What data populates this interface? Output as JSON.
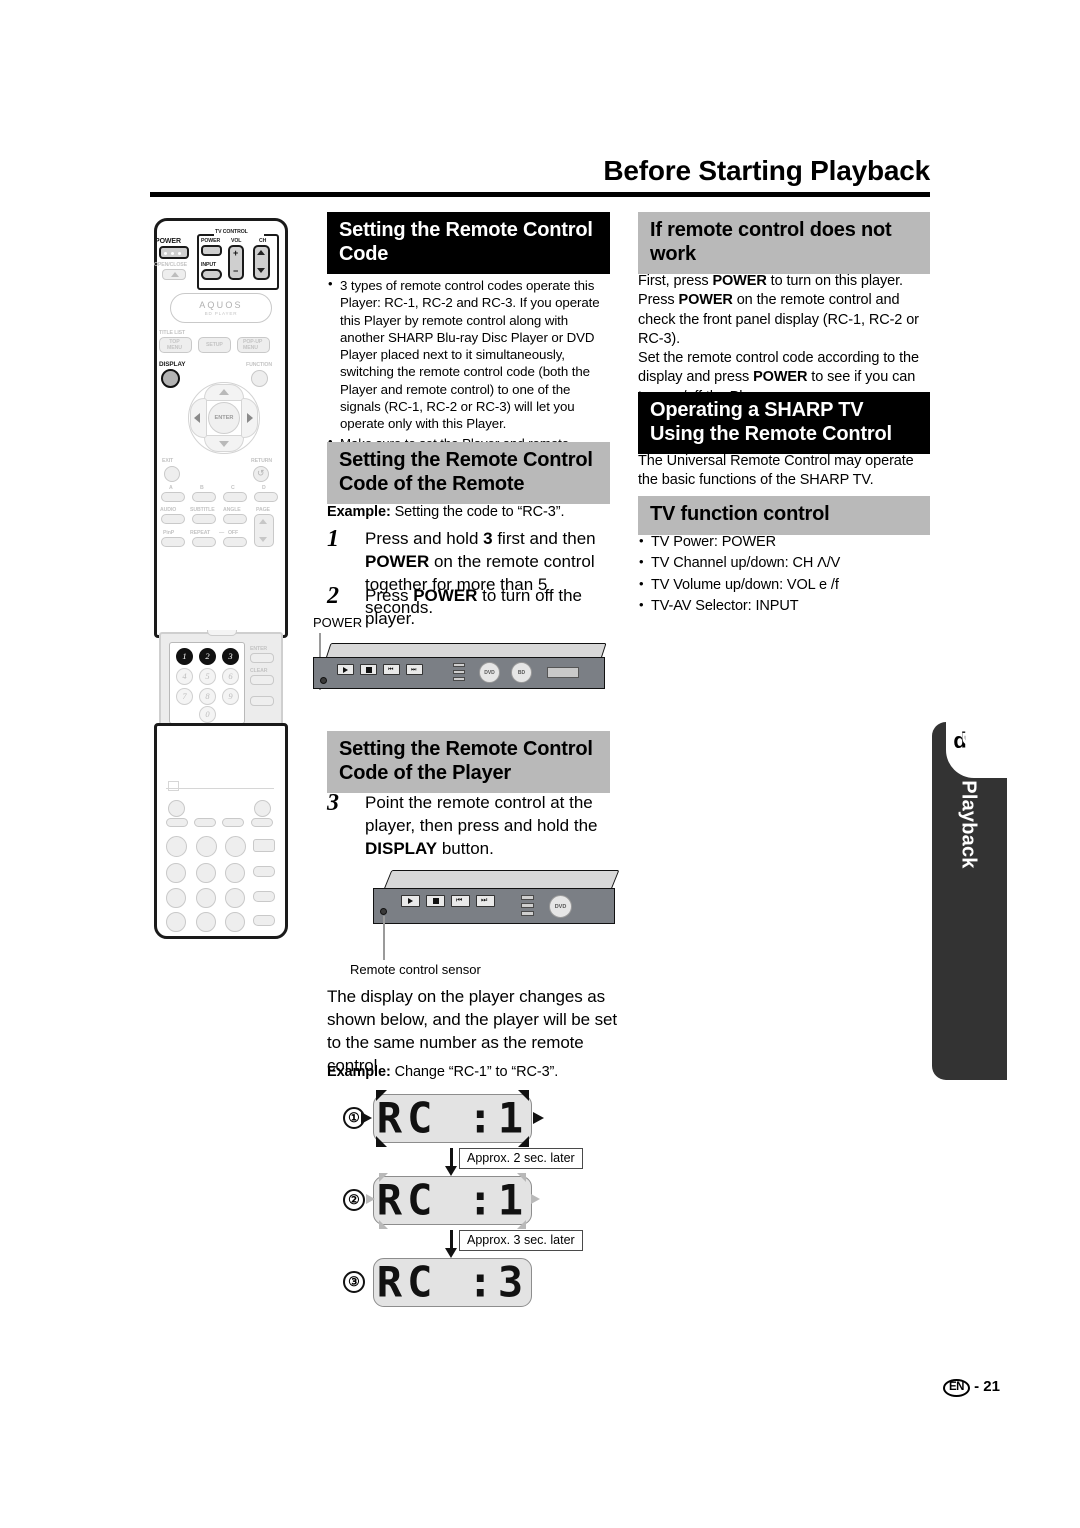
{
  "page": {
    "title": "Before Starting Playback",
    "footer_locale": "EN",
    "footer_page": "- 21"
  },
  "sidebar_tab": {
    "letter": "p",
    "label": "Disc Playback"
  },
  "left_column": {
    "remote": {
      "labels": {
        "power": "POWER",
        "open_close": "OPEN/CLOSE",
        "tv_control": "TV CONTROL",
        "tv_power": "POWER",
        "vol": "VOL",
        "ch": "CH",
        "input": "INPUT",
        "plus": "+",
        "minus": "−",
        "aquos": "AQUOS",
        "aquos_sub": "BD PLAYER",
        "title_list": "TITLE LIST",
        "top_menu": "TOP\nMENU",
        "setup": "SETUP",
        "popup_menu": "POP-UP\nMENU",
        "display": "DISPLAY",
        "function": "FUNCTION",
        "enter": "ENTER",
        "exit": "EXIT",
        "return": "RETURN",
        "a": "A",
        "b": "B",
        "c": "C",
        "d": "D",
        "audio": "AUDIO",
        "subtitle": "SUBTITLE",
        "angle": "ANGLE",
        "page": "PAGE",
        "pinp": "PinP",
        "repeat": "REPEAT",
        "dash": "—",
        "off": "OFF",
        "enter2": "ENTER",
        "clear": "CLEAR",
        "keys": [
          "1",
          "2",
          "3",
          "4",
          "5",
          "6",
          "7",
          "8",
          "9",
          "0"
        ],
        "highlighted_keys": [
          "1",
          "2",
          "3"
        ]
      }
    }
  },
  "middle_column": {
    "section1": {
      "heading": "Setting the Remote Control Code",
      "bullets": [
        "3 types of remote control codes operate this Player: RC-1, RC-2 and RC-3. If you operate this Player by remote control along with another SHARP Blu-ray Disc Player or DVD Player placed next to it simultaneously, switching the remote control code (both the Player and remote control) to one of the signals (RC-1, RC-2 or RC-3) will let you operate only with this Player.",
        "Make sure to set the Player and remote control to the same remote code. You can not operate the Player if they are not set to the same code."
      ]
    },
    "section2": {
      "heading": "Setting the Remote Control Code of the Remote",
      "example_label": "Example:",
      "example_text": "Setting the code to “RC-3”.",
      "steps": [
        {
          "num": "1",
          "html": "Press and hold <b>3</b> first and then <b>POWER</b> on the remote control together for more than 5 seconds."
        },
        {
          "num": "2",
          "html": "Press <b>POWER</b> to turn off the player."
        }
      ],
      "figure_label": "POWER"
    },
    "section3": {
      "heading": "Setting the Remote Control Code of the Player",
      "steps": [
        {
          "num": "3",
          "html": "Point the remote control at the player, then press and hold the <b>DISPLAY</b> button."
        }
      ],
      "sensor_label": "Remote control sensor",
      "paragraph": "The display on the player changes as shown below, and the player will be set to the same number as the remote control.",
      "example_label": "Example:",
      "example_text": "Change “RC-1” to “RC-3”."
    },
    "display_sequence": {
      "steps": [
        {
          "index": "①",
          "text": "RC :1",
          "flash": "strong"
        },
        {
          "index": "②",
          "text": "RC :1",
          "flash": "weak"
        },
        {
          "index": "③",
          "text": "RC :3",
          "flash": "none"
        }
      ],
      "transitions": [
        "Approx. 2 sec. later",
        "Approx. 3 sec. later"
      ]
    }
  },
  "right_column": {
    "section1": {
      "heading": "If remote control does not work",
      "paragraph_html": "First, press <b>POWER</b> to turn on this player. Press <b>POWER</b> on the remote control and check the front panel display (RC-1, RC-2 or RC-3).<br>Set the remote control code according to the display and press <b>POWER</b> to see if you can turn on/off the Player."
    },
    "section2": {
      "heading": "Operating a SHARP TV Using the Remote Control",
      "paragraph": "The Universal Remote Control may operate the basic functions of the SHARP TV."
    },
    "section3": {
      "heading": "TV function control",
      "bullets": [
        "TV Power: POWER",
        "TV Channel up/down: CH Λ/V",
        "TV Volume up/down: VOL e /f",
        "TV-AV Selector: INPUT"
      ]
    }
  }
}
